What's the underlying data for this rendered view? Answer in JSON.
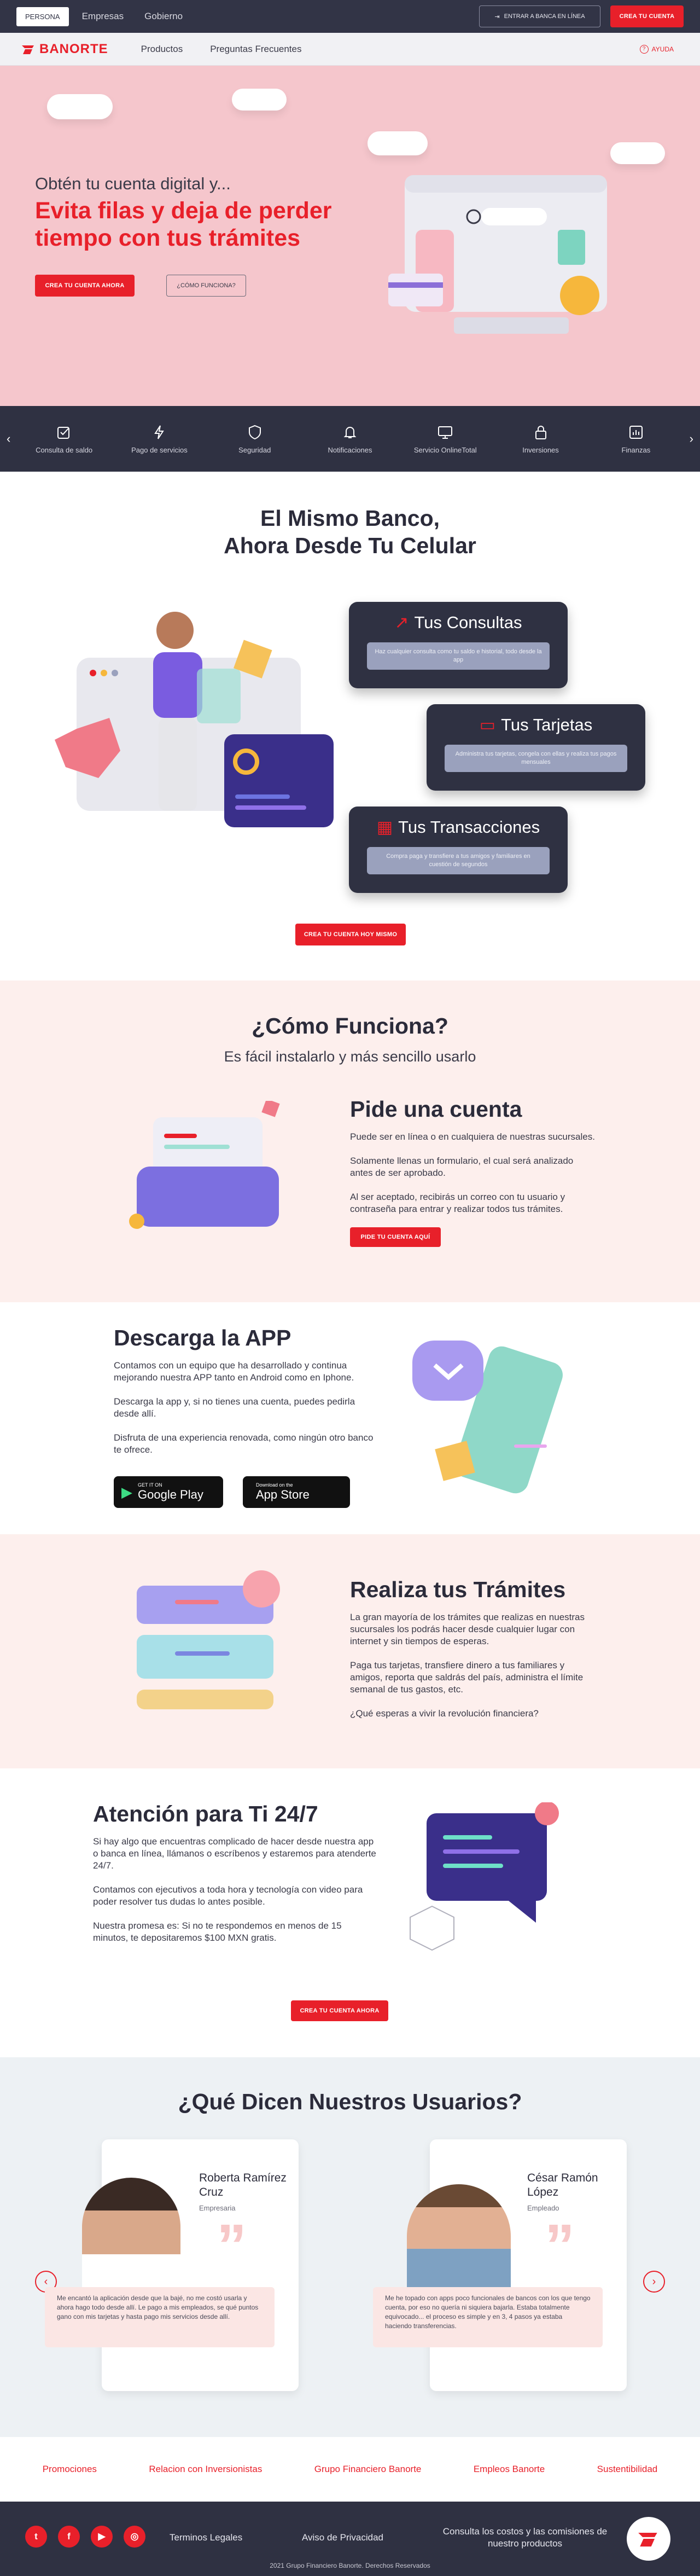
{
  "topbar": {
    "segments": [
      "PERSONA",
      "Empresas",
      "Gobierno"
    ],
    "bank_online": "ENTRAR A BANCA EN LÍNEA",
    "create_account": "CREA TU CUENTA"
  },
  "nav": {
    "brand": "BANORTE",
    "links": [
      "Productos",
      "Preguntas Frecuentes"
    ],
    "help": "AYUDA"
  },
  "hero": {
    "lead": "Obtén tu cuenta digital y...",
    "headline": "Evita filas y deja de perder tiempo con tus trámites",
    "cta_primary": "CREA TU CUENTA AHORA",
    "cta_secondary": "¿CÓMO FUNCIONA?"
  },
  "quick_menu": {
    "items": [
      {
        "label": "Consulta de saldo",
        "icon": "check-square-icon"
      },
      {
        "label": "Pago de servicios",
        "icon": "bolt-icon"
      },
      {
        "label": "Seguridad",
        "icon": "shield-icon"
      },
      {
        "label": "Notificaciones",
        "icon": "bell-icon"
      },
      {
        "label": "Servicio OnlineTotal",
        "icon": "monitor-icon"
      },
      {
        "label": "Inversiones",
        "icon": "lock-icon"
      },
      {
        "label": "Finanzas",
        "icon": "chart-icon"
      }
    ]
  },
  "banking": {
    "title_line1": "El Mismo Banco,",
    "title_line2": "Ahora Desde Tu Celular",
    "features": [
      {
        "title": "Tus Consultas",
        "desc": "Haz cualquier consulta como tu saldo e historial, todo desde la app",
        "icon": "trend-icon"
      },
      {
        "title": "Tus Tarjetas",
        "desc": "Administra tus tarjetas, congela con ellas y realiza tus pagos mensuales",
        "icon": "card-icon"
      },
      {
        "title": "Tus Transacciones",
        "desc": "Compra paga y transfiere a tus amigos y familiares en cuestión de segundos",
        "icon": "calculator-icon"
      }
    ],
    "cta": "CREA TU CUENTA HOY MISMO"
  },
  "how": {
    "title": "¿Cómo Funciona?",
    "subtitle": "Es fácil instalarlo y más sencillo usarlo",
    "heading": "Pide una cuenta",
    "p1": "Puede ser en línea o en cualquiera de nuestras sucursales.",
    "p2": "Solamente llenas un formulario, el cual será analizado antes de ser aprobado.",
    "p3": "Al ser aceptado, recibirás un correo con tu usuario y contraseña para entrar y realizar todos tus trámites.",
    "cta": "PIDE TU CUENTA AQUÍ"
  },
  "download": {
    "heading": "Descarga la APP",
    "p1": "Contamos con un equipo que ha desarrollado y continua mejorando nuestra APP tanto en Android como en Iphone.",
    "p2": "Descarga la app y, si no tienes una cuenta, puedes pedirla desde allí.",
    "p3": "Disfruta de una experiencia renovada, como ningún otro banco te ofrece.",
    "google_small": "GET IT ON",
    "google_big": "Google Play",
    "apple_small": "Download on the",
    "apple_big": "App Store"
  },
  "procedures": {
    "heading": "Realiza tus Trámites",
    "p1": "La gran mayoría de los trámites que realizas en nuestras sucursales los podrás hacer desde cualquier lugar con internet y sin tiempos de esperas.",
    "p2": "Paga tus tarjetas, transfiere dinero a tus familiares y amigos, reporta que saldrás del país, administra el límite semanal de tus gastos, etc.",
    "p3": "¿Qué esperas a vivir la revolución financiera?"
  },
  "support": {
    "heading": "Atención para Ti 24/7",
    "p1": "Si hay algo que encuentras complicado de hacer desde nuestra app o banca en línea, llámanos o escríbenos y estaremos para atenderte 24/7.",
    "p2": "Contamos con ejecutivos a toda hora y tecnología con video para poder resolver tus dudas lo antes posible.",
    "p3": "Nuestra promesa es: Si no te respondemos en menos de 15 minutos, te depositaremos $100 MXN gratis.",
    "cta": "CREA TU CUENTA AHORA"
  },
  "testimonials": {
    "title": "¿Qué Dicen Nuestros Usuarios?",
    "items": [
      {
        "name": "Roberta Ramírez Cruz",
        "role": "Empresaria",
        "quote": "Me encantó la aplicación desde que la bajé, no me costó usarla y ahora hago todo desde allí. Le pago a mis empleados, se qué puntos gano con mis tarjetas y hasta pago mis servicios desde allí."
      },
      {
        "name": "César Ramón López",
        "role": "Empleado",
        "quote": "Me he topado con apps poco funcionales de bancos con los que tengo cuenta, por eso no quería ni siquiera bajarla. Estaba totalmente equivocado... el proceso es simple y en 3, 4 pasos ya estaba haciendo transferencias."
      }
    ]
  },
  "footer_links": [
    "Promociones",
    "Relacion con Inversionistas",
    "Grupo Financiero Banorte",
    "Empleos Banorte",
    "Sustentibilidad"
  ],
  "footer": {
    "social": [
      {
        "icon": "twitter-icon",
        "glyph": "t"
      },
      {
        "icon": "facebook-icon",
        "glyph": "f"
      },
      {
        "icon": "youtube-icon",
        "glyph": "▶"
      },
      {
        "icon": "instagram-icon",
        "glyph": "◎"
      }
    ],
    "terms": "Terminos Legales",
    "privacy": "Aviso de Privacidad",
    "costs": "Consulta los costos y las comisiones de nuestro productos",
    "copyright": "2021 Grupo Financiero Banorte. Derechos Reservados"
  },
  "colors": {
    "brand_red": "#e8202a",
    "dark": "#2f3142",
    "hero_pink": "#f5c6cc",
    "soft_pink": "#fdefed"
  }
}
